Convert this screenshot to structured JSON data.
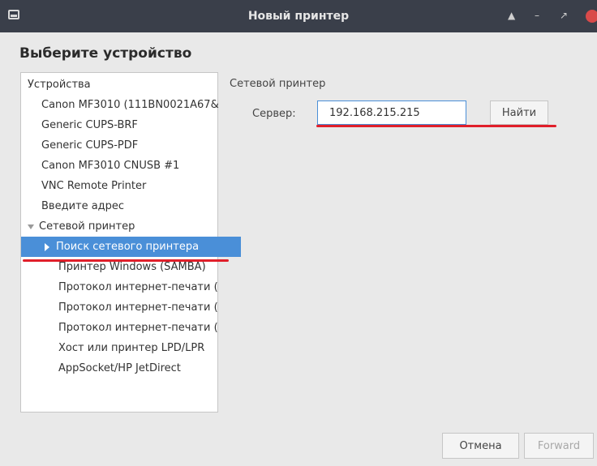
{
  "window": {
    "title": "Новый принтер",
    "controls": [
      "up-arrow-icon",
      "minimize-icon",
      "restore-icon",
      "close-icon"
    ]
  },
  "heading": "Выберите устройство",
  "device_tree": {
    "items": [
      {
        "label": "Устройства",
        "level": 0
      },
      {
        "label": "Canon MF3010 (111BN0021A67&",
        "level": 1
      },
      {
        "label": "Generic CUPS-BRF",
        "level": 1
      },
      {
        "label": "Generic CUPS-PDF",
        "level": 1
      },
      {
        "label": "Canon MF3010 CNUSB #1",
        "level": 1
      },
      {
        "label": "VNC Remote Printer",
        "level": 1
      },
      {
        "label": "Введите адрес",
        "level": 1
      },
      {
        "label": "Сетевой принтер",
        "level": 1,
        "expanded": true
      },
      {
        "label": "Поиск сетевого принтера",
        "level": 2,
        "selected": true
      },
      {
        "label": "Принтер Windows (SAMBA)",
        "level": 2
      },
      {
        "label": "Протокол интернет-печати (",
        "level": 2
      },
      {
        "label": "Протокол интернет-печати (",
        "level": 2
      },
      {
        "label": "Протокол интернет-печати (",
        "level": 2
      },
      {
        "label": "Хост или принтер LPD/LPR",
        "level": 2
      },
      {
        "label": "AppSocket/HP JetDirect",
        "level": 2
      }
    ]
  },
  "network_panel": {
    "section_title": "Сетевой принтер",
    "server_label": "Сервер:",
    "server_value": "192.168.215.215",
    "find_button": "Найти"
  },
  "footer": {
    "cancel_button": "Отмена",
    "forward_button": "Forward"
  },
  "colors": {
    "titlebar": "#3a3f4a",
    "selection": "#4a8fd8",
    "annotation_underline": "#e01f2a",
    "close_button": "#d94a4a"
  }
}
